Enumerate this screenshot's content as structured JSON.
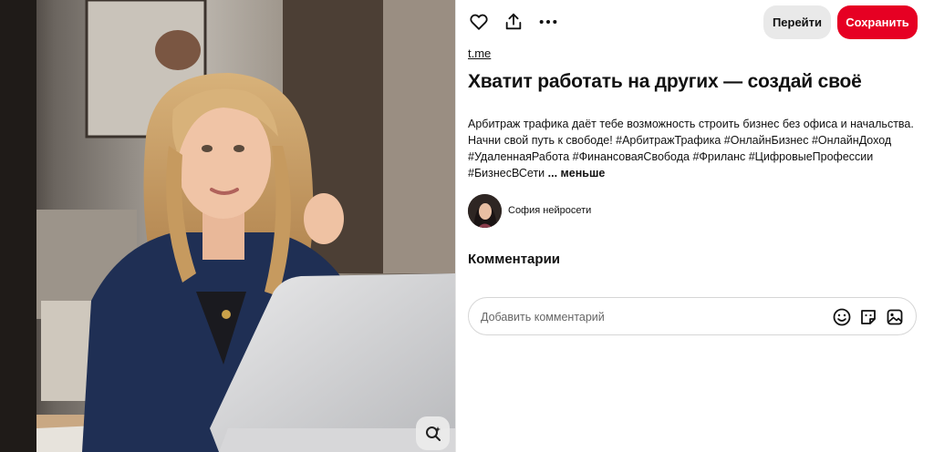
{
  "toolbar": {
    "icons": [
      "heart-icon",
      "share-icon",
      "more-icon"
    ],
    "go_label": "Перейти",
    "save_label": "Сохранить"
  },
  "pin": {
    "source": "t.me",
    "title": "Хватит работать на других — создай своё",
    "description": "Арбитраж трафика даёт тебе возможность строить бизнес без офиса и начальства. Начни свой путь к свободе! #АрбитражТрафика #ОнлайнБизнес #ОнлайнДоход #УдаленнаяРабота #ФинансоваяСвобода #Фриланс #ЦифровыеПрофессии #БизнесВСети",
    "less_label": "... меньше"
  },
  "author": {
    "name": "София нейросети"
  },
  "comments": {
    "title": "Комментарии",
    "placeholder": "Добавить комментарий",
    "icons": [
      "emoji-icon",
      "sticker-icon",
      "image-icon"
    ]
  },
  "colors": {
    "save_red": "#e60023",
    "go_gray": "#e9e9e9",
    "text": "#111111"
  }
}
